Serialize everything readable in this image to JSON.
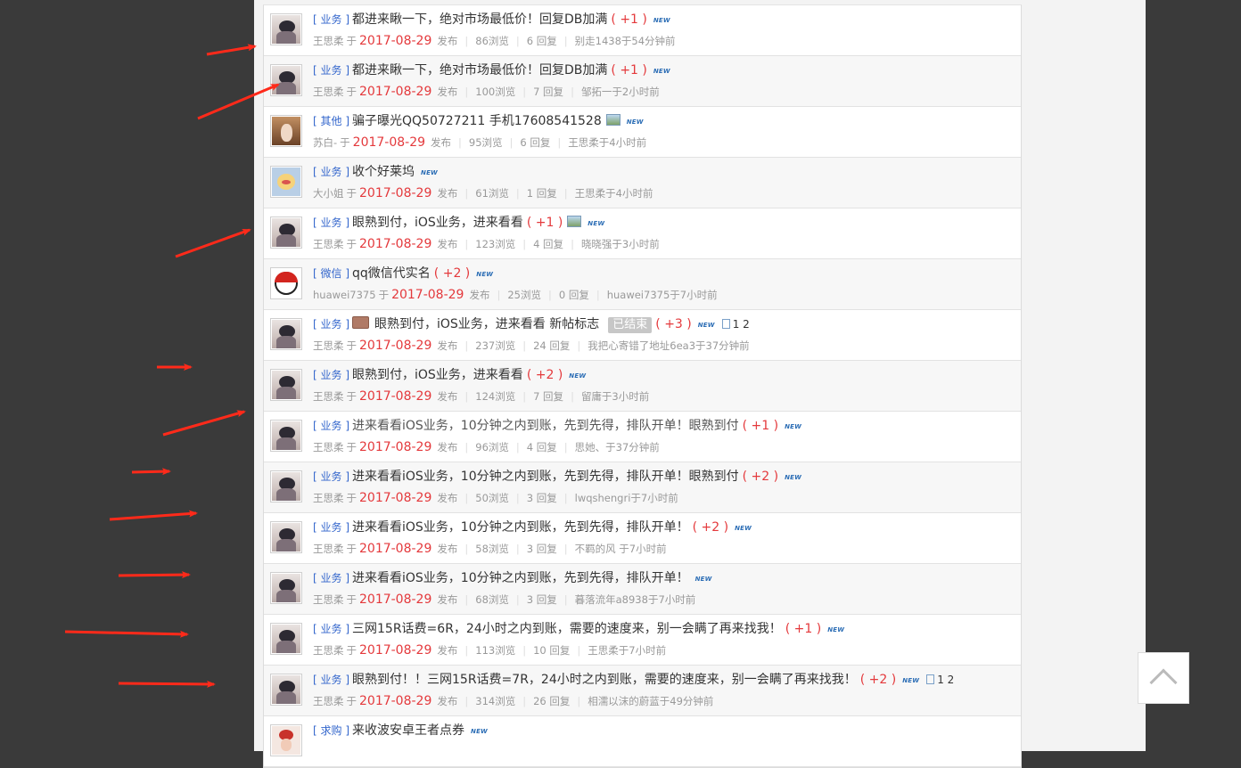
{
  "colors": {
    "page_background": "#3a3a3a",
    "link": "#3366cc",
    "accent_red": "#e4393c",
    "annotation_arrow": "#ff2a1a"
  },
  "icons": {
    "new_badge": "new-badge-icon",
    "image_attachment": "image-icon",
    "multi_page": "page-icon",
    "back_to_top": "chevron-up-icon"
  },
  "threads": [
    {
      "cat": "业务",
      "title": "都进来瞅一下，绝对市场最低价！回复DB加满",
      "plus": "( +1 )",
      "author": "王思柔",
      "yu": "于",
      "date": "2017-08-29",
      "fb": "发布",
      "views": "86浏览",
      "replies": "6 回复",
      "last": "别走1438于54分钟前",
      "avatar": "type-a"
    },
    {
      "cat": "业务",
      "title": "都进来瞅一下，绝对市场最低价！回复DB加满",
      "plus": "( +1 )",
      "author": "王思柔",
      "yu": "于",
      "date": "2017-08-29",
      "fb": "发布",
      "views": "100浏览",
      "replies": "7 回复",
      "last": "邹拓一于2小时前",
      "avatar": "type-a"
    },
    {
      "cat": "其他",
      "title": "骗子曝光QQ50727211  手机17608541528",
      "plus": "",
      "img": true,
      "author": "苏白-",
      "yu": "于",
      "date": "2017-08-29",
      "fb": "发布",
      "views": "95浏览",
      "replies": "6 回复",
      "last": "王思柔于4小时前",
      "avatar": "type-b"
    },
    {
      "cat": "业务",
      "title": "收个好莱坞",
      "plus": "",
      "author": "大小姐",
      "yu": "于",
      "date": "2017-08-29",
      "fb": "发布",
      "views": "61浏览",
      "replies": "1 回复",
      "last": "王思柔于4小时前",
      "avatar": "type-c"
    },
    {
      "cat": "业务",
      "title": "眼熟到付，iOS业务，进来看看",
      "plus": "( +1 )",
      "img": true,
      "author": "王思柔",
      "yu": "于",
      "date": "2017-08-29",
      "fb": "发布",
      "views": "123浏览",
      "replies": "4 回复",
      "last": "晓晓强于3小时前",
      "avatar": "type-a"
    },
    {
      "cat": "微信",
      "title": "qq微信代实名",
      "plus": "( +2 )",
      "author": "huawei7375",
      "yu": "于",
      "date": "2017-08-29",
      "fb": "发布",
      "views": "25浏览",
      "replies": "0 回复",
      "last": "huawei7375于7小时前",
      "avatar": "type-d"
    },
    {
      "cat": "业务",
      "title": "眼熟到付，iOS业务，进来看看  新帖标志",
      "plus": "( +3 )",
      "folder": true,
      "closed": "已结束",
      "pages": "1 2",
      "author": "王思柔",
      "yu": "于",
      "date": "2017-08-29",
      "fb": "发布",
      "views": "237浏览",
      "replies": "24 回复",
      "last": "我把心寄错了地址6ea3于37分钟前",
      "avatar": "type-a"
    },
    {
      "cat": "业务",
      "title": "眼熟到付，iOS业务，进来看看",
      "plus": "( +2 )",
      "author": "王思柔",
      "yu": "于",
      "date": "2017-08-29",
      "fb": "发布",
      "views": "124浏览",
      "replies": "7 回复",
      "last": "留庸于3小时前",
      "avatar": "type-a"
    },
    {
      "cat": "业务",
      "title": "进来看看iOS业务，10分钟之内到账，先到先得，排队开单！眼熟到付",
      "plus": "( +1 )",
      "gray": true,
      "author": "王思柔",
      "yu": "于",
      "date": "2017-08-29",
      "fb": "发布",
      "views": "96浏览",
      "replies": "4 回复",
      "last": "思她、于37分钟前",
      "avatar": "type-a"
    },
    {
      "cat": "业务",
      "title": "进来看看iOS业务，10分钟之内到账，先到先得，排队开单！眼熟到付",
      "plus": "( +2 )",
      "author": "王思柔",
      "yu": "于",
      "date": "2017-08-29",
      "fb": "发布",
      "views": "50浏览",
      "replies": "3 回复",
      "last": "lwqshengri于7小时前",
      "avatar": "type-a"
    },
    {
      "cat": "业务",
      "title": "进来看看iOS业务，10分钟之内到账，先到先得，排队开单！",
      "plus": "( +2 )",
      "author": "王思柔",
      "yu": "于",
      "date": "2017-08-29",
      "fb": "发布",
      "views": "58浏览",
      "replies": "3 回复",
      "last": "不羁的风   于7小时前",
      "avatar": "type-a"
    },
    {
      "cat": "业务",
      "title": "进来看看iOS业务，10分钟之内到账，先到先得，排队开单！",
      "plus": "",
      "author": "王思柔",
      "yu": "于",
      "date": "2017-08-29",
      "fb": "发布",
      "views": "68浏览",
      "replies": "3 回复",
      "last": "暮落流年a8938于7小时前",
      "avatar": "type-a"
    },
    {
      "cat": "业务",
      "title": "三网15R话费=6R，24小时之内到账，需要的速度来，别一会瞒了再来找我！",
      "plus": "( +1 )",
      "author": "王思柔",
      "yu": "于",
      "date": "2017-08-29",
      "fb": "发布",
      "views": "113浏览",
      "replies": "10 回复",
      "last": "王思柔于7小时前",
      "avatar": "type-a"
    },
    {
      "cat": "业务",
      "title": "眼熟到付！！三网15R话费=7R，24小时之内到账，需要的速度来，别一会瞒了再来找我！",
      "plus": "( +2 )",
      "pages": "1 2",
      "author": "王思柔",
      "yu": "于",
      "date": "2017-08-29",
      "fb": "发布",
      "views": "314浏览",
      "replies": "26 回复",
      "last": "相濡以沫的蔚蓝于49分钟前",
      "avatar": "type-a"
    },
    {
      "cat": "求购",
      "title": "来收波安卓王者点券",
      "plus": "",
      "author": "",
      "yu": "",
      "date": "",
      "fb": "",
      "views": "",
      "replies": "",
      "last": "",
      "avatar": "type-e"
    }
  ],
  "new_badge_text": "NEW"
}
